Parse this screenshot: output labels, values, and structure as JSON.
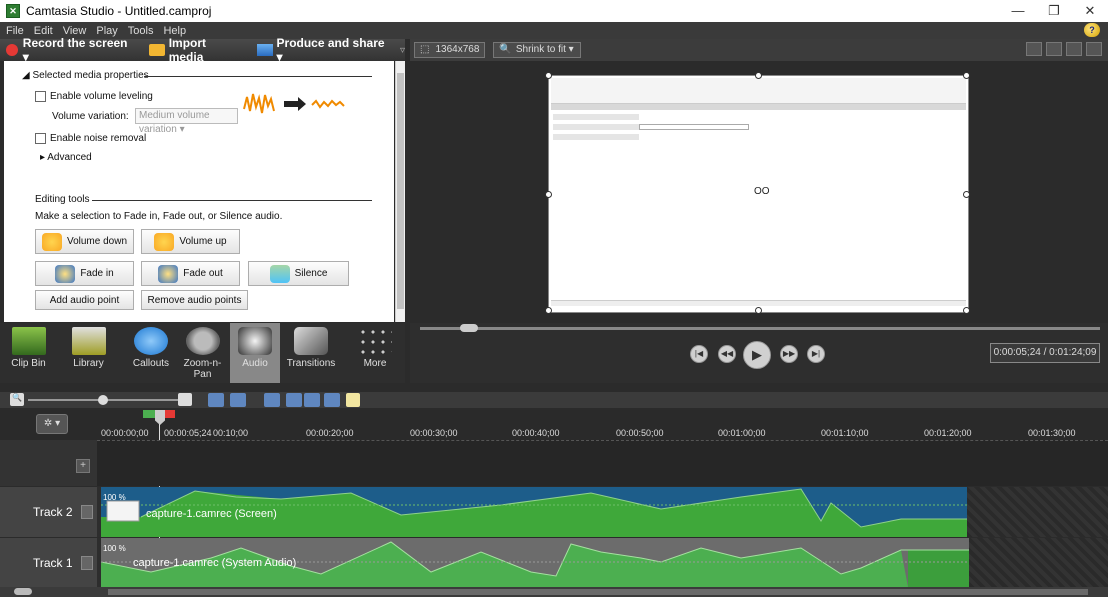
{
  "window": {
    "title": "Camtasia Studio - Untitled.camproj",
    "minimize": "—",
    "restore": "❐",
    "close": "✕"
  },
  "menu": [
    "File",
    "Edit",
    "View",
    "Play",
    "Tools",
    "Help"
  ],
  "toolbar": {
    "record_label": "Record the screen ▾",
    "import_label": "Import media",
    "share_label": "Produce and share ▾",
    "overflow": "▿"
  },
  "properties": {
    "section_media": "Selected media properties",
    "enable_volume_leveling": "Enable volume leveling",
    "volume_variation_label": "Volume variation:",
    "volume_variation_value": "Medium volume variation",
    "enable_noise_removal": "Enable noise removal",
    "advanced": "Advanced",
    "section_editing": "Editing tools",
    "editing_hint": "Make a selection to Fade in, Fade out, or Silence audio.",
    "btn_volume_down": "Volume down",
    "btn_volume_up": "Volume up",
    "btn_fade_in": "Fade in",
    "btn_fade_out": "Fade out",
    "btn_silence": "Silence",
    "btn_add_audio_point": "Add audio point",
    "btn_remove_audio_points": "Remove audio points"
  },
  "preview": {
    "dimensions": "1364x768",
    "zoom": "Shrink to fit"
  },
  "tabs": [
    {
      "label": "Clip Bin",
      "icon": "clip-bin-icon"
    },
    {
      "label": "Library",
      "icon": "library-icon"
    },
    {
      "label": "Callouts",
      "icon": "callouts-icon"
    },
    {
      "label": "Zoom-n-\nPan",
      "icon": "zoom-icon"
    },
    {
      "label": "Audio",
      "icon": "audio-icon",
      "active": true
    },
    {
      "label": "Transitions",
      "icon": "transitions-icon"
    },
    {
      "label": "More",
      "icon": "more-icon"
    }
  ],
  "player": {
    "time": "0:00:05;24 / 0:01:24;09"
  },
  "timeline": {
    "playhead_time": "00:00:05;24",
    "ticks": [
      "00:00:00;00",
      "00:10;00",
      "00:00:20;00",
      "00:00:30;00",
      "00:00:40;00",
      "00:00:50;00",
      "00:01:00;00",
      "00:01:10;00",
      "00:01:20;00",
      "00:01:30;00"
    ],
    "tracks": [
      {
        "name": "Track 2",
        "clip": "capture-1.camrec (Screen)",
        "volume": "100 %"
      },
      {
        "name": "Track 1",
        "clip": "capture-1.camrec (System Audio)",
        "volume": "100 %"
      }
    ]
  },
  "colors": {
    "accent_green": "#3fa83a",
    "dark_bg": "#2b2b2b",
    "track_blue": "#1d5d8a"
  }
}
